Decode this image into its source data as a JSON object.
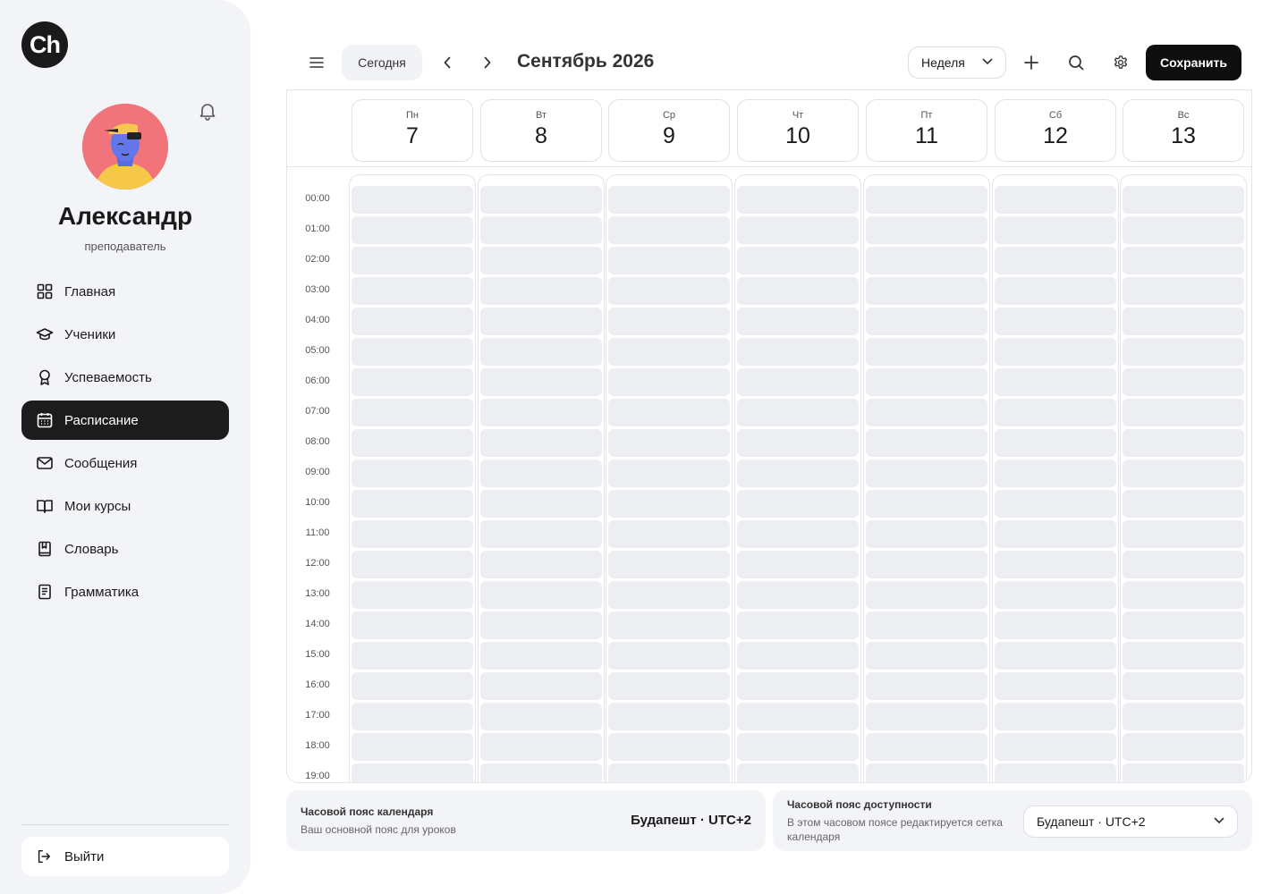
{
  "brand": {
    "logo_text": "Ch"
  },
  "user": {
    "name": "Александр",
    "role": "преподаватель"
  },
  "nav": {
    "items": [
      {
        "label": "Главная",
        "icon": "grid-icon"
      },
      {
        "label": "Ученики",
        "icon": "graduation-cap-icon"
      },
      {
        "label": "Успеваемость",
        "icon": "award-icon"
      },
      {
        "label": "Расписание",
        "icon": "calendar-icon",
        "active": true
      },
      {
        "label": "Сообщения",
        "icon": "mail-icon"
      },
      {
        "label": "Мои курсы",
        "icon": "book-open-icon"
      },
      {
        "label": "Словарь",
        "icon": "dictionary-icon"
      },
      {
        "label": "Грамматика",
        "icon": "notebook-icon"
      }
    ],
    "logout_label": "Выйти"
  },
  "toolbar": {
    "today_label": "Сегодня",
    "month_title": "Сентябрь 2026",
    "view_label": "Неделя",
    "save_label": "Сохранить"
  },
  "week": {
    "days": [
      {
        "name": "Пн",
        "num": "7"
      },
      {
        "name": "Вт",
        "num": "8"
      },
      {
        "name": "Ср",
        "num": "9"
      },
      {
        "name": "Чт",
        "num": "10"
      },
      {
        "name": "Пт",
        "num": "11"
      },
      {
        "name": "Сб",
        "num": "12"
      },
      {
        "name": "Вс",
        "num": "13"
      }
    ],
    "times": [
      "00:00",
      "01:00",
      "02:00",
      "03:00",
      "04:00",
      "05:00",
      "06:00",
      "07:00",
      "08:00",
      "09:00",
      "10:00",
      "11:00",
      "12:00",
      "13:00",
      "14:00",
      "15:00",
      "16:00",
      "17:00",
      "18:00",
      "19:00"
    ]
  },
  "timezone": {
    "calendar_title": "Часовой пояс календаря",
    "calendar_sub": "Ваш основной пояс для уроков",
    "calendar_value": "Будапешт · UTC+2",
    "availability_title": "Часовой пояс доступности",
    "availability_sub": "В этом часовом поясе редактируется сетка календаря",
    "availability_value": "Будапешт · UTC+2"
  },
  "colors": {
    "accent": "#1c1c1c",
    "slot": "#eceef1",
    "sidebar": "#f3f4f7",
    "avatar_bg": "#f0747a"
  }
}
